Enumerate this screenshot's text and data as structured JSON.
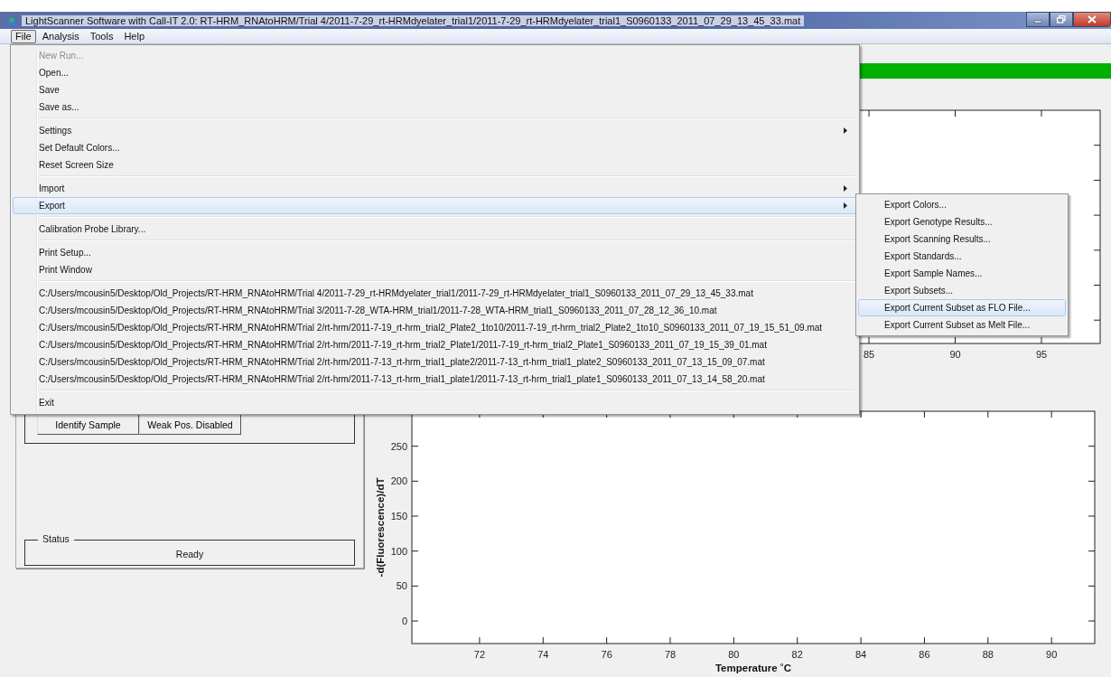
{
  "window": {
    "title": "LightScanner Software with Call-IT 2.0: RT-HRM_RNAtoHRM/Trial 4/2011-7-29_rt-HRMdyelater_trial1/2011-7-29_rt-HRMdyelater_trial1_S0960133_2011_07_29_13_45_33.mat"
  },
  "menubar": [
    {
      "label": "File",
      "selected": true
    },
    {
      "label": "Analysis",
      "selected": false
    },
    {
      "label": "Tools",
      "selected": false
    },
    {
      "label": "Help",
      "selected": false
    }
  ],
  "file_menu": [
    {
      "kind": "item",
      "label": "New Run...",
      "disabled": true,
      "submenu": false,
      "selected": false
    },
    {
      "kind": "item",
      "label": "Open...",
      "disabled": false,
      "submenu": false,
      "selected": false
    },
    {
      "kind": "item",
      "label": "Save",
      "disabled": false,
      "submenu": false,
      "selected": false
    },
    {
      "kind": "item",
      "label": "Save as...",
      "disabled": false,
      "submenu": false,
      "selected": false
    },
    {
      "kind": "separator"
    },
    {
      "kind": "item",
      "label": "Settings",
      "disabled": false,
      "submenu": true,
      "selected": false
    },
    {
      "kind": "item",
      "label": "Set Default Colors...",
      "disabled": false,
      "submenu": false,
      "selected": false
    },
    {
      "kind": "item",
      "label": "Reset Screen Size",
      "disabled": false,
      "submenu": false,
      "selected": false
    },
    {
      "kind": "separator"
    },
    {
      "kind": "item",
      "label": "Import",
      "disabled": false,
      "submenu": true,
      "selected": false
    },
    {
      "kind": "item",
      "label": "Export",
      "disabled": false,
      "submenu": true,
      "selected": true
    },
    {
      "kind": "separator"
    },
    {
      "kind": "item",
      "label": "Calibration Probe Library...",
      "disabled": false,
      "submenu": false,
      "selected": false
    },
    {
      "kind": "separator"
    },
    {
      "kind": "item",
      "label": "Print Setup...",
      "disabled": false,
      "submenu": false,
      "selected": false
    },
    {
      "kind": "item",
      "label": "Print Window",
      "disabled": false,
      "submenu": false,
      "selected": false
    },
    {
      "kind": "separator"
    },
    {
      "kind": "item",
      "label": "C:/Users/mcousin5/Desktop/Old_Projects/RT-HRM_RNAtoHRM/Trial 4/2011-7-29_rt-HRMdyelater_trial1/2011-7-29_rt-HRMdyelater_trial1_S0960133_2011_07_29_13_45_33.mat",
      "disabled": false,
      "submenu": false,
      "selected": false
    },
    {
      "kind": "item",
      "label": "C:/Users/mcousin5/Desktop/Old_Projects/RT-HRM_RNAtoHRM/Trial 3/2011-7-28_WTA-HRM_trial1/2011-7-28_WTA-HRM_trial1_S0960133_2011_07_28_12_36_10.mat",
      "disabled": false,
      "submenu": false,
      "selected": false
    },
    {
      "kind": "item",
      "label": "C:/Users/mcousin5/Desktop/Old_Projects/RT-HRM_RNAtoHRM/Trial 2/rt-hrm/2011-7-19_rt-hrm_trial2_Plate2_1to10/2011-7-19_rt-hrm_trial2_Plate2_1to10_S0960133_2011_07_19_15_51_09.mat",
      "disabled": false,
      "submenu": false,
      "selected": false
    },
    {
      "kind": "item",
      "label": "C:/Users/mcousin5/Desktop/Old_Projects/RT-HRM_RNAtoHRM/Trial 2/rt-hrm/2011-7-19_rt-hrm_trial2_Plate1/2011-7-19_rt-hrm_trial2_Plate1_S0960133_2011_07_19_15_39_01.mat",
      "disabled": false,
      "submenu": false,
      "selected": false
    },
    {
      "kind": "item",
      "label": "C:/Users/mcousin5/Desktop/Old_Projects/RT-HRM_RNAtoHRM/Trial 2/rt-hrm/2011-7-13_rt-hrm_trial1_plate2/2011-7-13_rt-hrm_trial1_plate2_S0960133_2011_07_13_15_09_07.mat",
      "disabled": false,
      "submenu": false,
      "selected": false
    },
    {
      "kind": "item",
      "label": "C:/Users/mcousin5/Desktop/Old_Projects/RT-HRM_RNAtoHRM/Trial 2/rt-hrm/2011-7-13_rt-hrm_trial1_plate1/2011-7-13_rt-hrm_trial1_plate1_S0960133_2011_07_13_14_58_20.mat",
      "disabled": false,
      "submenu": false,
      "selected": false
    },
    {
      "kind": "separator"
    },
    {
      "kind": "item",
      "label": "Exit",
      "disabled": false,
      "submenu": false,
      "selected": false
    }
  ],
  "export_submenu": [
    {
      "label": "Export Colors...",
      "selected": false
    },
    {
      "label": "Export Genotype Results...",
      "selected": false
    },
    {
      "label": "Export Scanning Results...",
      "selected": false
    },
    {
      "label": "Export Standards...",
      "selected": false
    },
    {
      "label": "Export Sample Names...",
      "selected": false
    },
    {
      "label": "Export Subsets...",
      "selected": false
    },
    {
      "label": "Export Current Subset as FLO File...",
      "selected": true
    },
    {
      "label": "Export Current Subset as Melt File...",
      "selected": false
    }
  ],
  "left_panel": {
    "buttons": [
      "Identify Sample",
      "Weak Pos. Disabled"
    ],
    "status": {
      "title": "Status",
      "value": "Ready"
    }
  },
  "upper_chart": {
    "progress": {
      "level": 1
    },
    "x_tick_labels": [
      "85",
      "90",
      "95"
    ]
  },
  "lower_chart": {
    "chart_data": {
      "type": "line",
      "xlabel": "Temperature ˚C",
      "ylabel": "-d(Fluorescence)/dT",
      "xlim": [
        69.87,
        91.36
      ],
      "ylim": [
        -32.3,
        300
      ],
      "xticks": [
        72,
        74,
        76,
        78,
        80,
        82,
        84,
        86,
        88,
        90
      ],
      "yticks": [
        0,
        50,
        100,
        150,
        200,
        250
      ]
    }
  }
}
